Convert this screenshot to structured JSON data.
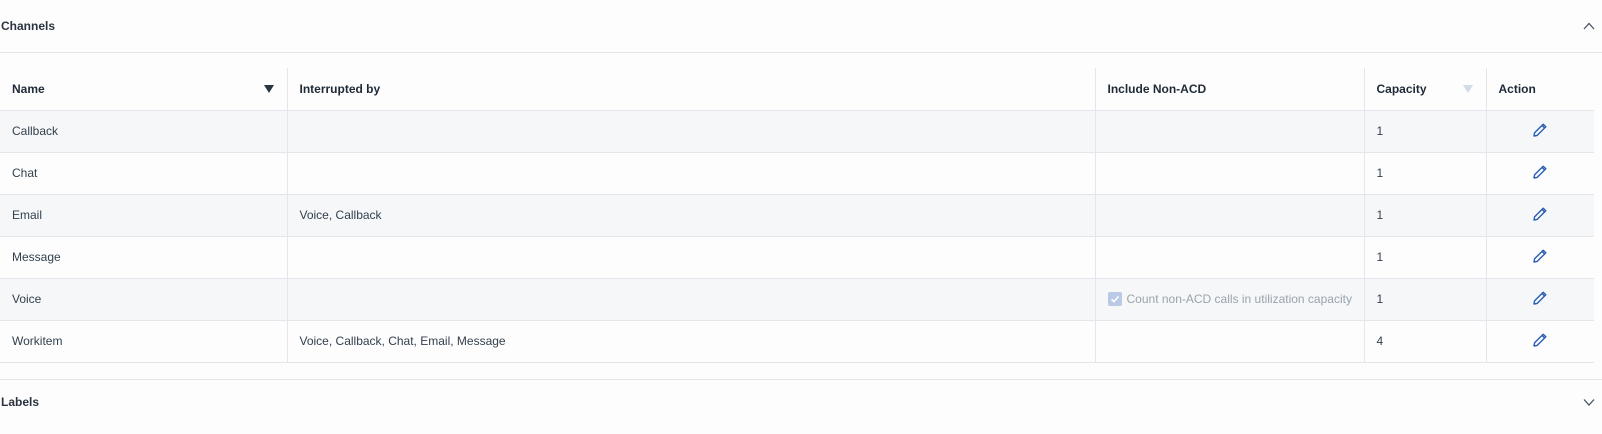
{
  "channels_section": {
    "title": "Channels",
    "chevron_icon": "chevron-up-icon"
  },
  "table": {
    "headers": {
      "name": "Name",
      "interrupted_by": "Interrupted by",
      "include_non_acd": "Include Non-ACD",
      "capacity": "Capacity",
      "action": "Action"
    },
    "rows": [
      {
        "name": "Callback",
        "interrupted_by": "",
        "include_non_acd": "",
        "capacity": "1"
      },
      {
        "name": "Chat",
        "interrupted_by": "",
        "include_non_acd": "",
        "capacity": "1"
      },
      {
        "name": "Email",
        "interrupted_by": "Voice, Callback",
        "include_non_acd": "",
        "capacity": "1"
      },
      {
        "name": "Message",
        "interrupted_by": "",
        "include_non_acd": "",
        "capacity": "1"
      },
      {
        "name": "Voice",
        "interrupted_by": "",
        "include_non_acd": "Count non-ACD calls in utilization capacity",
        "non_acd_checked": true,
        "capacity": "1"
      },
      {
        "name": "Workitem",
        "interrupted_by": "Voice, Callback, Chat, Email, Message",
        "include_non_acd": "",
        "capacity": "4"
      }
    ]
  },
  "labels_section": {
    "title": "Labels",
    "chevron_icon": "chevron-down-icon"
  },
  "colors": {
    "accent": "#2a5db0",
    "checkbox_disabled": "#b9c9e6",
    "row_alt": "#f6f7f9",
    "border": "#e3e6ea"
  }
}
